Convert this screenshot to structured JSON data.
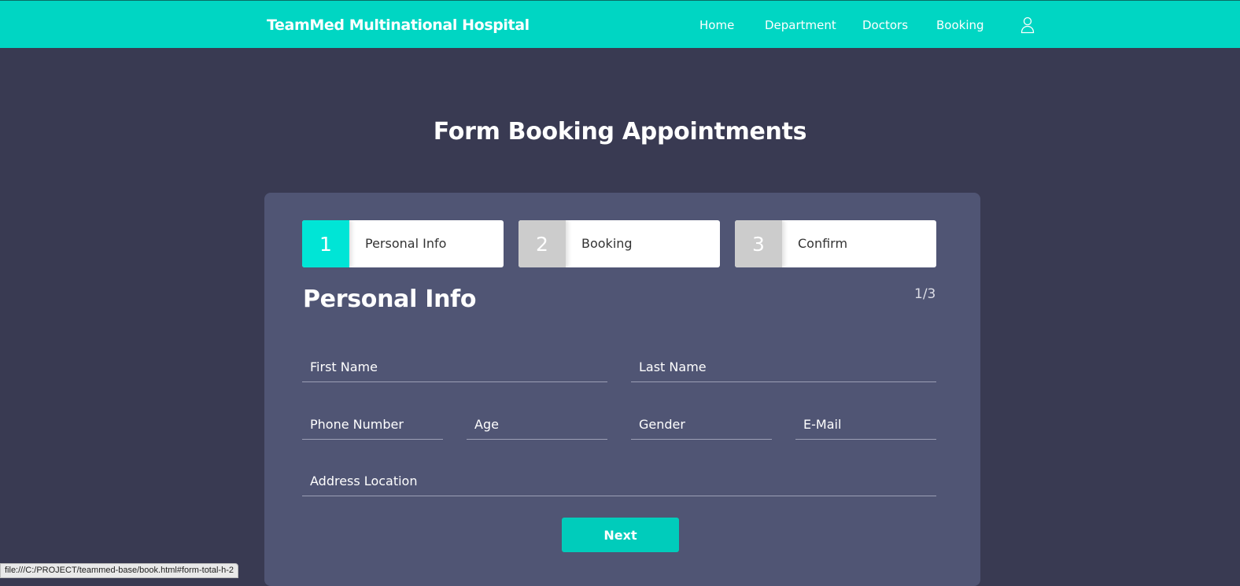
{
  "nav": {
    "brand": "TeamMed Multinational Hospital",
    "links": [
      "Home",
      "Department",
      "Doctors",
      "Booking"
    ],
    "account_icon": "user-icon"
  },
  "page_title": "Form Booking Appointments",
  "steps": [
    {
      "number": "1",
      "label": "Personal Info",
      "color": "#00e5d6",
      "active": true
    },
    {
      "number": "2",
      "label": "Booking",
      "color": "#cccccc",
      "active": false
    },
    {
      "number": "3",
      "label": "Confirm",
      "color": "#cccccc",
      "active": false
    }
  ],
  "form": {
    "section_title": "Personal Info",
    "pager": "1/3",
    "fields": {
      "first_name": "First Name",
      "last_name": "Last Name",
      "phone": "Phone Number",
      "age": "Age",
      "gender": "Gender",
      "email": "E-Mail",
      "address": "Address Location"
    },
    "next_label": "Next"
  },
  "status_bar_url": "file:///C:/PROJECT/teammed-base/book.html#form-total-h-2",
  "colors": {
    "accent": "#00d6c3",
    "background": "#393a52",
    "card": "#505574"
  }
}
